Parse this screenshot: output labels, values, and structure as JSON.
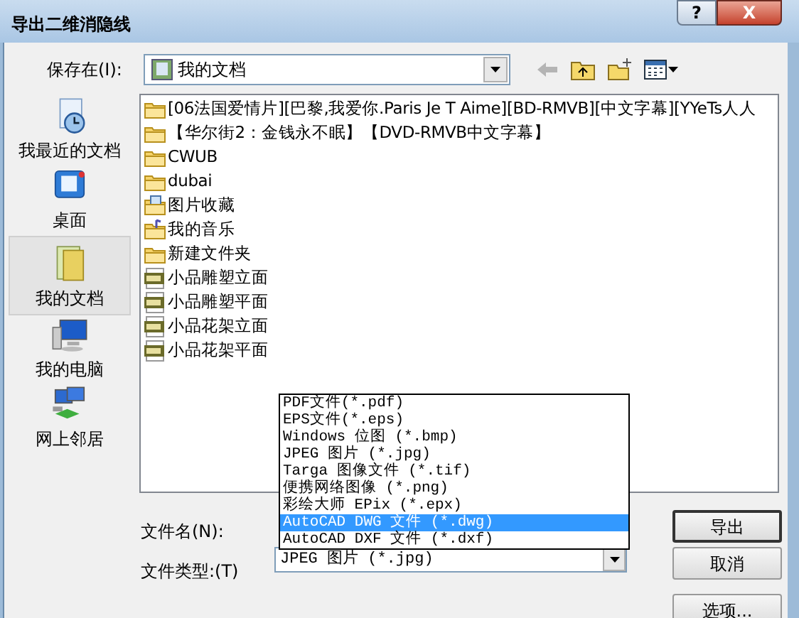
{
  "window": {
    "title": "导出二维消隐线",
    "help_button": "?",
    "close_button": "X"
  },
  "save_in": {
    "label": "保存在(I):",
    "value": "我的文档"
  },
  "sidebar": {
    "items": [
      {
        "label": "我最近的文档",
        "kind": "recent",
        "selected": false
      },
      {
        "label": "桌面",
        "kind": "desktop",
        "selected": false
      },
      {
        "label": "我的文档",
        "kind": "documents",
        "selected": true
      },
      {
        "label": "我的电脑",
        "kind": "computer",
        "selected": false
      },
      {
        "label": "网上邻居",
        "kind": "network",
        "selected": false
      }
    ]
  },
  "files": [
    {
      "name": "[06法国爱情片][巴黎,我爱你.Paris Je T Aime][BD-RMVB][中文字幕][YYeTs人人",
      "kind": "folder"
    },
    {
      "name": "【华尔街2：金钱永不眠】【DVD-RMVB中文字幕】",
      "kind": "folder"
    },
    {
      "name": "CWUB",
      "kind": "folder"
    },
    {
      "name": "dubai",
      "kind": "folder"
    },
    {
      "name": "图片收藏",
      "kind": "pictures"
    },
    {
      "name": "我的音乐",
      "kind": "music"
    },
    {
      "name": "新建文件夹",
      "kind": "folder"
    },
    {
      "name": "小品雕塑立面",
      "kind": "jpg"
    },
    {
      "name": "小品雕塑平面",
      "kind": "jpg"
    },
    {
      "name": "小品花架立面",
      "kind": "jpg"
    },
    {
      "name": "小品花架平面",
      "kind": "jpg"
    }
  ],
  "file_name": {
    "label": "文件名(N):"
  },
  "file_type": {
    "label": "文件类型:(T)",
    "value": "JPEG 图片 (*.jpg)",
    "expanded": true,
    "options": [
      {
        "label": "PDF文件(*.pdf)",
        "highlighted": false
      },
      {
        "label": "EPS文件(*.eps)",
        "highlighted": false
      },
      {
        "label": "Windows 位图 (*.bmp)",
        "highlighted": false
      },
      {
        "label": "JPEG 图片 (*.jpg)",
        "highlighted": false
      },
      {
        "label": "Targa 图像文件 (*.tif)",
        "highlighted": false
      },
      {
        "label": "便携网络图像 (*.png)",
        "highlighted": false
      },
      {
        "label": "彩绘大师 EPix (*.epx)",
        "highlighted": false
      },
      {
        "label": "AutoCAD DWG 文件 (*.dwg)",
        "highlighted": true
      },
      {
        "label": "AutoCAD DXF 文件 (*.dxf)",
        "highlighted": false
      }
    ]
  },
  "buttons": [
    {
      "label": "导出",
      "default": true
    },
    {
      "label": "取消",
      "default": false
    },
    {
      "label": "选项..."
    }
  ]
}
